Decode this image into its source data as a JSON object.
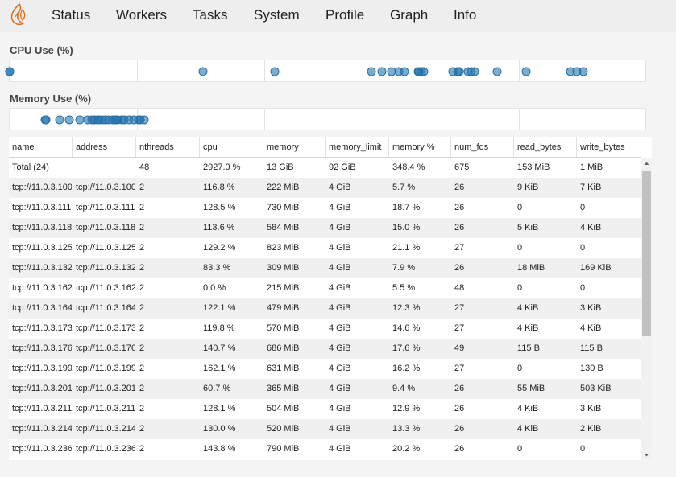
{
  "nav": {
    "logo_icon": "dask-flame-icon",
    "items": [
      "Status",
      "Workers",
      "Tasks",
      "System",
      "Profile",
      "Graph",
      "Info"
    ]
  },
  "cpu_plot": {
    "title": "CPU Use (%)",
    "points": [
      0.0,
      116.8,
      128.5,
      113.6,
      129.2,
      83.3,
      0.0,
      122.1,
      119.8,
      140.7,
      162.1,
      60.7,
      128.1,
      130.0,
      143.8,
      141.0,
      146.0,
      124.0,
      139.0,
      145.0,
      176.0,
      178.0,
      180.0,
      153.0
    ]
  },
  "memory_plot": {
    "title": "Memory Use (%)",
    "points": [
      5.7,
      18.7,
      15.0,
      21.1,
      7.9,
      5.5,
      12.3,
      14.6,
      17.6,
      16.2,
      9.4,
      12.9,
      13.3,
      20.2,
      14.0,
      16.5,
      18.0,
      15.5,
      17.0,
      19.5,
      20.5,
      11.0,
      13.8,
      16.8
    ]
  },
  "colors": {
    "dot_fill": "#1f77b4",
    "dot_stroke": "#2f6f9f",
    "alt_row": "#f0f0f0"
  },
  "table": {
    "columns": [
      "name",
      "address",
      "nthreads",
      "cpu",
      "memory",
      "memory_limit",
      "memory %",
      "num_fds",
      "read_bytes",
      "write_bytes"
    ],
    "rows": [
      [
        "Total (24)",
        "",
        "48",
        "2927.0 %",
        "13 GiB",
        "92 GiB",
        "348.4 %",
        "675",
        "153 MiB",
        "1 MiB"
      ],
      [
        "tcp://11.0.3.100",
        "tcp://11.0.3.100",
        "2",
        "116.8 %",
        "222 MiB",
        "4 GiB",
        "5.7 %",
        "26",
        "9 KiB",
        "7 KiB"
      ],
      [
        "tcp://11.0.3.111",
        "tcp://11.0.3.111",
        "2",
        "128.5 %",
        "730 MiB",
        "4 GiB",
        "18.7 %",
        "26",
        "0",
        "0"
      ],
      [
        "tcp://11.0.3.118",
        "tcp://11.0.3.118",
        "2",
        "113.6 %",
        "584 MiB",
        "4 GiB",
        "15.0 %",
        "26",
        "5 KiB",
        "4 KiB"
      ],
      [
        "tcp://11.0.3.125",
        "tcp://11.0.3.125",
        "2",
        "129.2 %",
        "823 MiB",
        "4 GiB",
        "21.1 %",
        "27",
        "0",
        "0"
      ],
      [
        "tcp://11.0.3.132",
        "tcp://11.0.3.132",
        "2",
        "83.3 %",
        "309 MiB",
        "4 GiB",
        "7.9 %",
        "26",
        "18 MiB",
        "169 KiB"
      ],
      [
        "tcp://11.0.3.162",
        "tcp://11.0.3.162",
        "2",
        "0.0 %",
        "215 MiB",
        "4 GiB",
        "5.5 %",
        "48",
        "0",
        "0"
      ],
      [
        "tcp://11.0.3.164",
        "tcp://11.0.3.164",
        "2",
        "122.1 %",
        "479 MiB",
        "4 GiB",
        "12.3 %",
        "27",
        "4 KiB",
        "3 KiB"
      ],
      [
        "tcp://11.0.3.173",
        "tcp://11.0.3.173",
        "2",
        "119.8 %",
        "570 MiB",
        "4 GiB",
        "14.6 %",
        "27",
        "4 KiB",
        "4 KiB"
      ],
      [
        "tcp://11.0.3.176",
        "tcp://11.0.3.176",
        "2",
        "140.7 %",
        "686 MiB",
        "4 GiB",
        "17.6 %",
        "49",
        "115 B",
        "115 B"
      ],
      [
        "tcp://11.0.3.199",
        "tcp://11.0.3.199",
        "2",
        "162.1 %",
        "631 MiB",
        "4 GiB",
        "16.2 %",
        "27",
        "0",
        "130 B"
      ],
      [
        "tcp://11.0.3.201",
        "tcp://11.0.3.201",
        "2",
        "60.7 %",
        "365 MiB",
        "4 GiB",
        "9.4 %",
        "26",
        "55 MiB",
        "503 KiB"
      ],
      [
        "tcp://11.0.3.211",
        "tcp://11.0.3.211",
        "2",
        "128.1 %",
        "504 MiB",
        "4 GiB",
        "12.9 %",
        "26",
        "4 KiB",
        "3 KiB"
      ],
      [
        "tcp://11.0.3.214",
        "tcp://11.0.3.214",
        "2",
        "130.0 %",
        "520 MiB",
        "4 GiB",
        "13.3 %",
        "26",
        "4 KiB",
        "2 KiB"
      ],
      [
        "tcp://11.0.3.236",
        "tcp://11.0.3.236",
        "2",
        "143.8 %",
        "790 MiB",
        "4 GiB",
        "20.2 %",
        "26",
        "0",
        "0"
      ]
    ]
  }
}
